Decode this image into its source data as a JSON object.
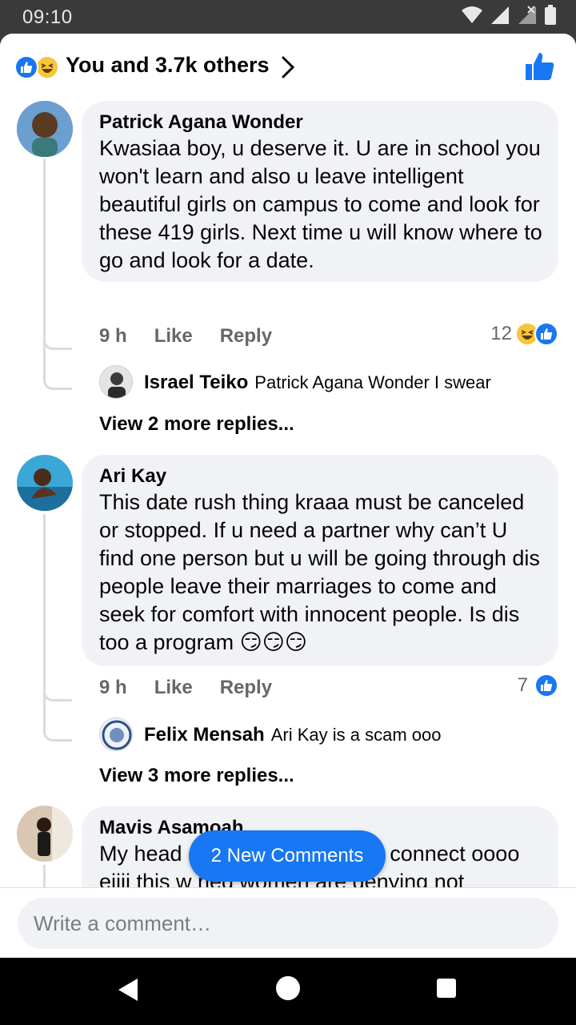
{
  "status_bar": {
    "time": "09:10"
  },
  "reactions_header": {
    "summary": "You and 3.7k others"
  },
  "comments": [
    {
      "author": "Patrick Agana Wonder",
      "text": "Kwasiaa boy, u deserve it. U are in school you won't learn and also u leave intelligent beautiful girls on campus to come and look for these 419 girls. Next time u will know where to go and look for a date.",
      "time": "9 h",
      "like_label": "Like",
      "reply_label": "Reply",
      "reaction_count": "12",
      "reply": {
        "author": "Israel Teiko",
        "text": "Patrick Agana Wonder I swear"
      },
      "view_more": "View 2 more replies..."
    },
    {
      "author": "Ari Kay",
      "text": "This date rush thing kraaa must be canceled or stopped. If u need a partner why can’t U find one person but u will be going through dis people leave their marriages to come and seek for comfort with innocent people. Is dis too a program 😏😏😏",
      "time": "9 h",
      "like_label": "Like",
      "reply_label": "Reply",
      "reaction_count": "7",
      "reply": {
        "author": "Felix Mensah",
        "text": "Ari Kay is a scam ooo"
      },
      "view_more": "View 3 more replies..."
    },
    {
      "author": "Mavis Asamoah",
      "text": "My head ooo my head ,I no fit connect oooo eiiii this w          ried women are denying not married what of we the single"
    }
  ],
  "new_comments_pill": "2 New Comments",
  "composer": {
    "placeholder": "Write a comment…"
  },
  "colors": {
    "accent": "#1877f2",
    "bubble": "#f0f2f5",
    "muted": "#65676b",
    "haha": "#f7c53b"
  }
}
